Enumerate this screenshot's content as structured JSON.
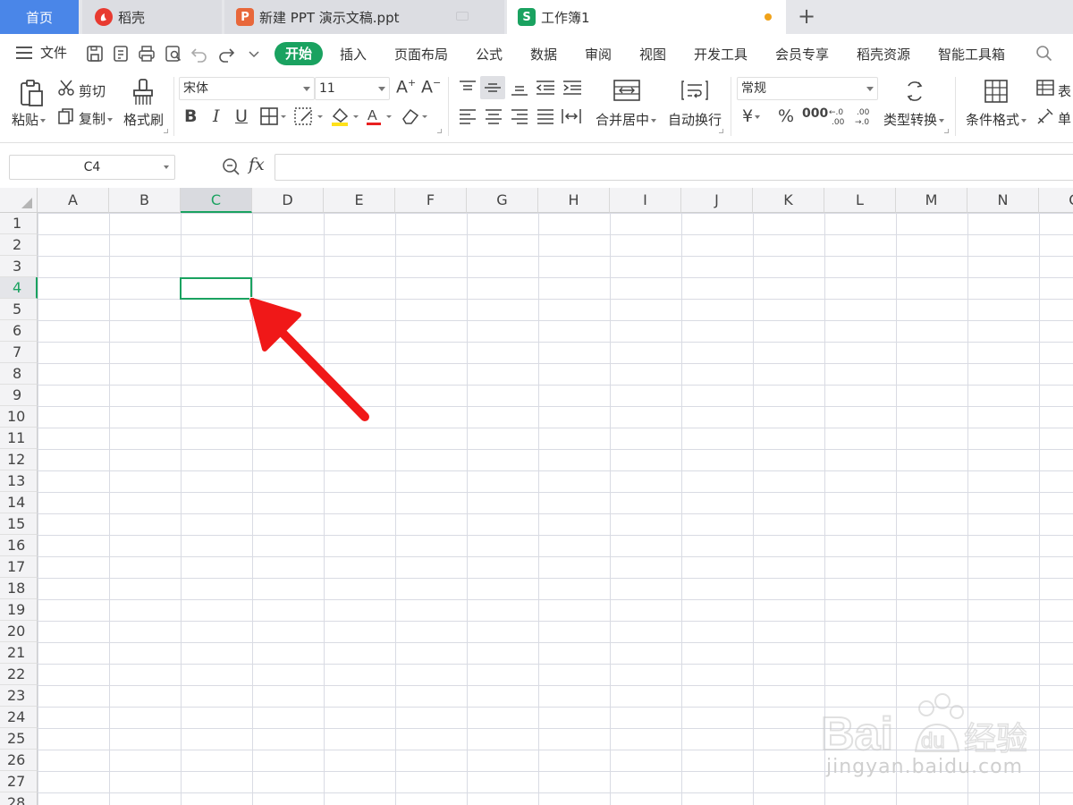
{
  "tabs": {
    "home": "首页",
    "daoke": "稻壳",
    "ppt": "新建 PPT 演示文稿.ppt",
    "workbook": "工作簿1",
    "daoke_icon": "daoke-logo-icon",
    "ppt_icon": "P",
    "workbook_icon": "S",
    "add": "+"
  },
  "menu": {
    "file": "文件",
    "items": [
      "开始",
      "插入",
      "页面布局",
      "公式",
      "数据",
      "审阅",
      "视图",
      "开发工具",
      "会员专享",
      "稻壳资源",
      "智能工具箱"
    ],
    "active_color": "#1aa260"
  },
  "ribbon": {
    "paste": "粘贴",
    "cut": "剪切",
    "copy": "复制",
    "format_painter": "格式刷",
    "font_name": "宋体",
    "font_size": "11",
    "bold": "B",
    "italic": "I",
    "underline": "U",
    "merge_center": "合并居中",
    "wrap_text": "自动换行",
    "number_format": "常规",
    "currency": "¥",
    "percent": "%",
    "thousands": "000",
    "type_convert": "类型转换",
    "conditional_format": "条件格式",
    "table_style": "表",
    "cell": "单"
  },
  "formula_bar": {
    "name_box": "C4",
    "fx": "fx",
    "value": ""
  },
  "sheet": {
    "columns": [
      "A",
      "B",
      "C",
      "D",
      "E",
      "F",
      "G",
      "H",
      "I",
      "J",
      "K",
      "L",
      "M",
      "N",
      "O"
    ],
    "rows": [
      "1",
      "2",
      "3",
      "4",
      "5",
      "6",
      "7",
      "8",
      "9",
      "10",
      "11",
      "12",
      "13",
      "14",
      "15",
      "16",
      "17",
      "18",
      "19",
      "20",
      "21",
      "22",
      "23",
      "24",
      "25",
      "26",
      "27",
      "28"
    ],
    "active_column": "C",
    "active_row": "4",
    "selection_color": "#1aa260"
  },
  "annotation": {
    "arrow_color": "#f01818"
  },
  "watermark": {
    "brand": "Bai du 经验",
    "url": "jingyan.baidu.com"
  }
}
